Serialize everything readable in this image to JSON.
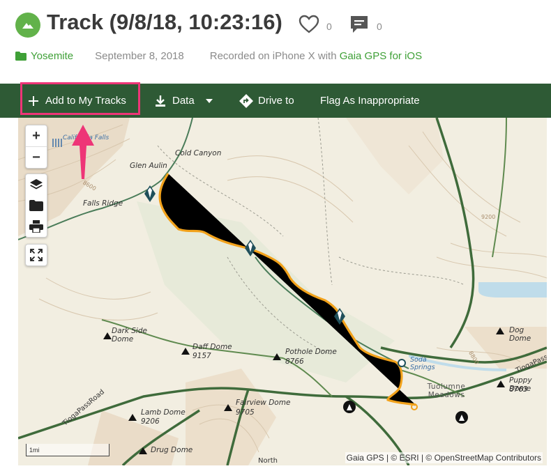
{
  "header": {
    "title": "Track (9/8/18, 10:23:16)",
    "likes": "0",
    "comments": "0",
    "folder": "Yosemite",
    "date": "September 8, 2018",
    "recorded_prefix": "Recorded on iPhone X with ",
    "recorded_app": "Gaia GPS for iOS"
  },
  "toolbar": {
    "add_label": "Add to My Tracks",
    "data_label": "Data",
    "drive_label": "Drive to",
    "flag_label": "Flag As Inappropriate"
  },
  "map": {
    "zoom_in": "+",
    "zoom_out": "−",
    "scale_label": "1mi",
    "attribution": "Gaia GPS | © ESRI | © OpenStreetMap Contributors",
    "labels": [
      "California Falls",
      "Glen Aulin",
      "Cold Canyon",
      "Falls Ridge",
      "8600",
      "Dark Side Dome",
      "Daff Dome",
      "9157",
      "Pothole Dome",
      "8766",
      "Soda Springs",
      "Tuolumne Meadows",
      "Dog Dome",
      "Puppy Dome",
      "8763",
      "Fairview Dome",
      "9705",
      "Lamb Dome",
      "9206",
      "Drug Dome",
      "TiogaPassRoad",
      "TiogaPass",
      "North",
      "9200",
      "8800"
    ]
  },
  "colors": {
    "accent_green": "#3fa037",
    "toolbar_bg": "#2e5a35",
    "highlight_pink": "#ee3577",
    "track_orange": "#f2a21b"
  }
}
